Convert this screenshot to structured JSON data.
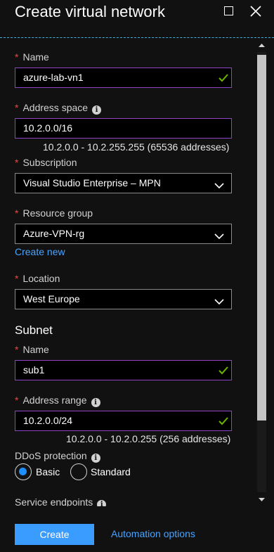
{
  "header": {
    "title": "Create virtual network"
  },
  "form": {
    "name": {
      "label": "Name",
      "value": "azure-lab-vn1"
    },
    "address_space": {
      "label": "Address space",
      "value": "10.2.0.0/16",
      "hint": "10.2.0.0 - 10.2.255.255 (65536 addresses)"
    },
    "subscription": {
      "label": "Subscription",
      "value": "Visual Studio Enterprise – MPN"
    },
    "resource_group": {
      "label": "Resource group",
      "value": "Azure-VPN-rg",
      "create_new": "Create new"
    },
    "location": {
      "label": "Location",
      "value": "West Europe"
    },
    "subnet": {
      "heading": "Subnet",
      "name": {
        "label": "Name",
        "value": "sub1"
      },
      "address_range": {
        "label": "Address range",
        "value": "10.2.0.0/24",
        "hint": "10.2.0.0 - 10.2.0.255 (256 addresses)"
      }
    },
    "ddos": {
      "label": "DDoS protection",
      "options": [
        "Basic",
        "Standard"
      ],
      "selected": "Basic"
    },
    "service_endpoints": {
      "label": "Service endpoints"
    }
  },
  "footer": {
    "create_label": "Create",
    "automation_label": "Automation options"
  },
  "colors": {
    "accent": "#3b9cff",
    "link": "#4aa3ff",
    "required": "#e8473f",
    "valid": "#6bb700",
    "input_border": "#8e44c4"
  }
}
